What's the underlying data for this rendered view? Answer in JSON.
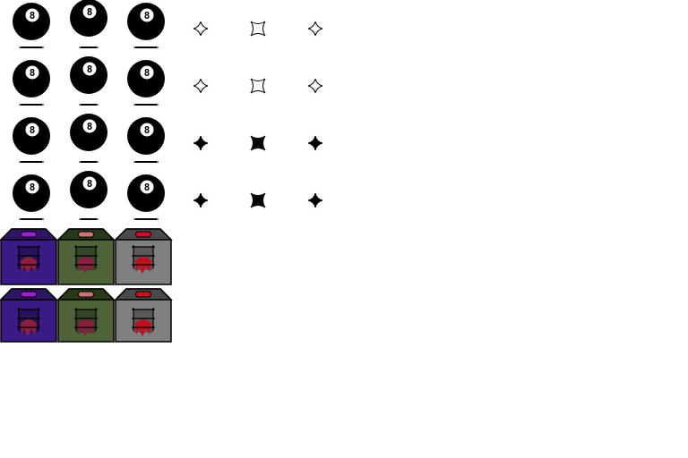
{
  "sprite_sheet": {
    "eight_ball": {
      "number": "8",
      "ball_color": "#000000",
      "label_color": "#ffffff"
    },
    "sparkle": {
      "outline_color": "#000000"
    },
    "boxes": [
      {
        "theme": "purple",
        "roof": "#2e1566",
        "body": "#3a1a85",
        "gem": "#a020d0"
      },
      {
        "theme": "green",
        "roof": "#263a18",
        "body": "#4e6338",
        "gem": "#d07080"
      },
      {
        "theme": "gray",
        "roof": "#4a4a4a",
        "body": "#808080",
        "gem": "#d01020"
      }
    ]
  }
}
